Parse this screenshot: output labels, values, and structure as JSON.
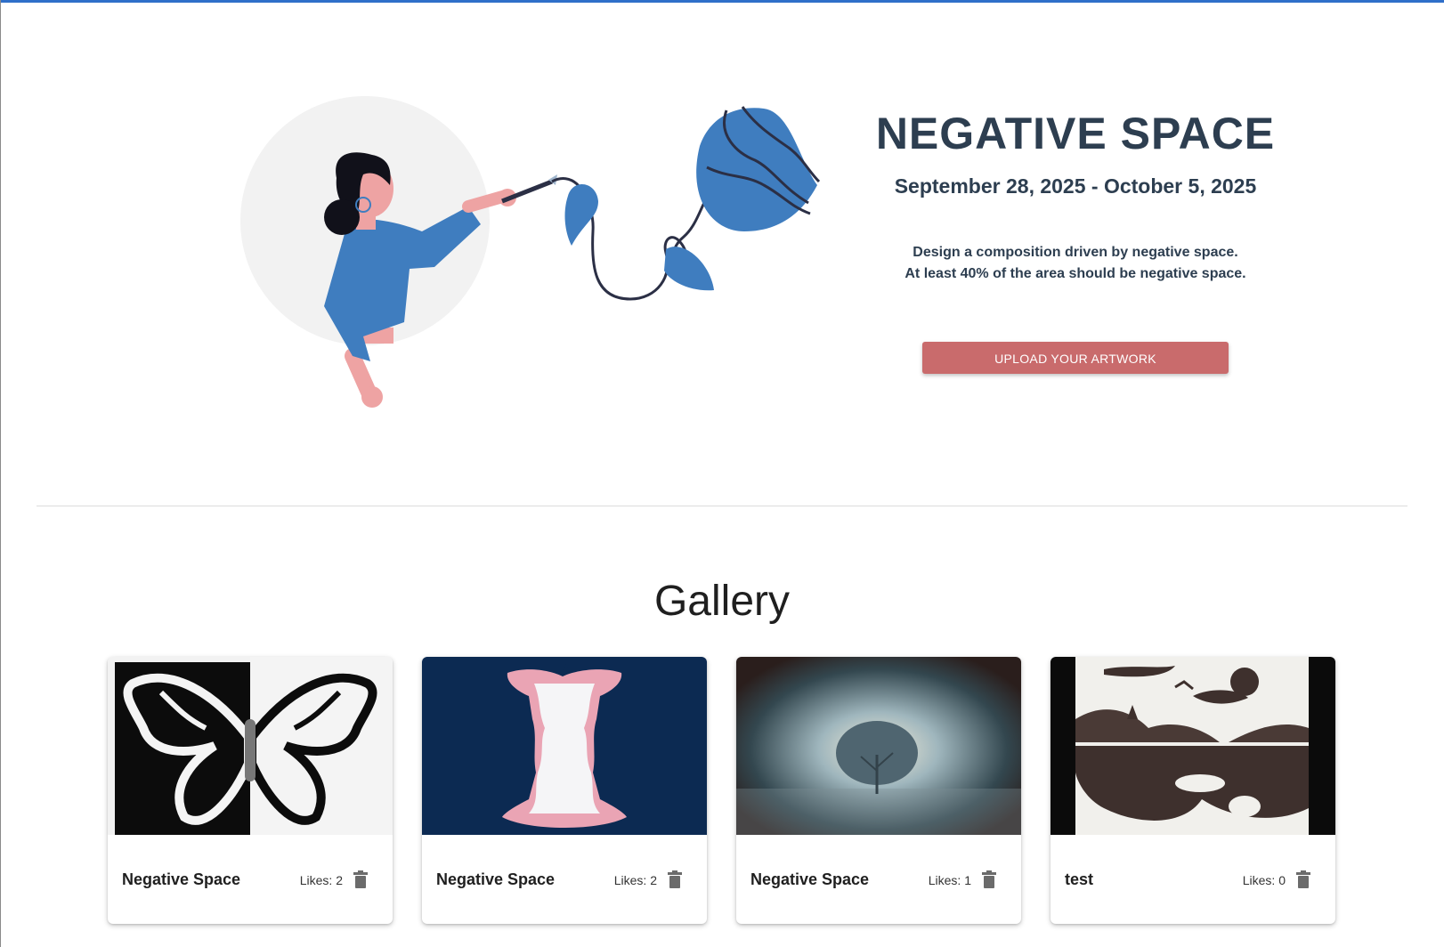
{
  "hero": {
    "title": "NEGATIVE SPACE",
    "dates": "September 28, 2025 - October 5, 2025",
    "description_line1": "Design a composition driven by negative space.",
    "description_line2": "At least 40% of the area should be negative space.",
    "upload_label": "UPLOAD YOUR ARTWORK",
    "illustration_icon": "painter-illustration"
  },
  "gallery": {
    "title": "Gallery",
    "cards": [
      {
        "title": "Negative Space",
        "likes": "Likes: 2",
        "image": "butterfly-artwork",
        "delete_icon": "trash-icon"
      },
      {
        "title": "Negative Space",
        "likes": "Likes: 2",
        "image": "apple-faces-artwork",
        "delete_icon": "trash-icon"
      },
      {
        "title": "Negative Space",
        "likes": "Likes: 1",
        "image": "tree-artwork",
        "delete_icon": "trash-icon"
      },
      {
        "title": "test",
        "likes": "Likes: 0",
        "image": "landscape-reflection-artwork",
        "delete_icon": "trash-icon"
      }
    ]
  },
  "colors": {
    "accent_button": "#c96b6c",
    "heading": "#2d3e50",
    "illustration_blue": "#3f7dbf",
    "top_bar": "#2f6fc9"
  }
}
